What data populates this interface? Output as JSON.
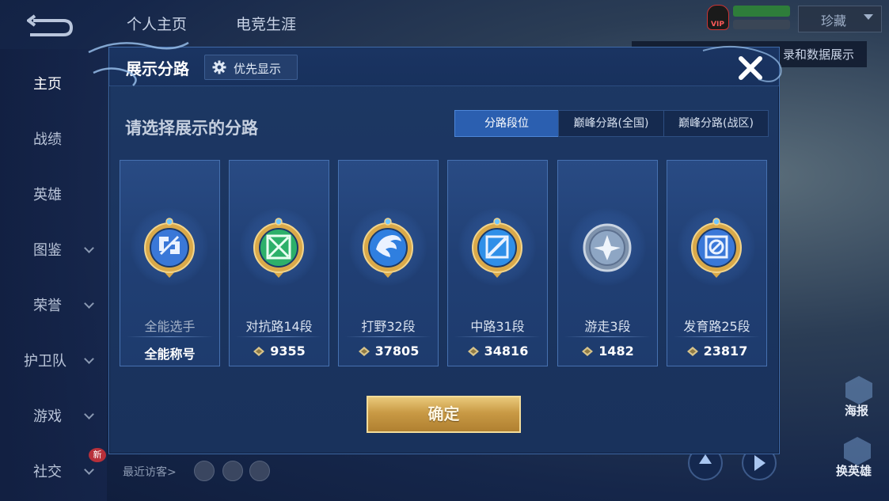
{
  "background": {
    "tabs": [
      "个人主页",
      "电竞生涯"
    ],
    "vip_label": "VIP",
    "dropdown_value": "珍藏",
    "side_strip_text": "录和数据展示",
    "sidebar": [
      {
        "label": "主页",
        "active": true,
        "has_chevron": false
      },
      {
        "label": "战绩",
        "active": false,
        "has_chevron": false
      },
      {
        "label": "英雄",
        "active": false,
        "has_chevron": false
      },
      {
        "label": "图鉴",
        "active": false,
        "has_chevron": true
      },
      {
        "label": "荣誉",
        "active": false,
        "has_chevron": true
      },
      {
        "label": "护卫队",
        "active": false,
        "has_chevron": true
      },
      {
        "label": "游戏",
        "active": false,
        "has_chevron": true
      },
      {
        "label": "社交",
        "active": false,
        "has_chevron": true
      }
    ],
    "new_badge": "新",
    "recent_visitors_label": "最近访客>",
    "right_labels": [
      "海报",
      "换英雄"
    ]
  },
  "modal": {
    "title": "展示分路",
    "priority_button": "优先显示",
    "section_title": "请选择展示的分路",
    "segments": [
      "分路段位",
      "巅峰分路(全国)",
      "巅峰分路(战区)"
    ],
    "active_segment": 0,
    "cards": [
      {
        "name": "全能选手",
        "score": "全能称号",
        "has_diamond": false,
        "emblem": "allround",
        "color": "#3a78d8"
      },
      {
        "name": "对抗路14段",
        "score": "9355",
        "has_diamond": true,
        "emblem": "clash",
        "color": "#2db06a"
      },
      {
        "name": "打野32段",
        "score": "37805",
        "has_diamond": true,
        "emblem": "jungle",
        "color": "#2f7fe0"
      },
      {
        "name": "中路31段",
        "score": "34816",
        "has_diamond": true,
        "emblem": "mid",
        "color": "#2f8fe8"
      },
      {
        "name": "游走3段",
        "score": "1482",
        "has_diamond": true,
        "emblem": "roam",
        "color": "#8ea6c4"
      },
      {
        "name": "发育路25段",
        "score": "23817",
        "has_diamond": true,
        "emblem": "farm",
        "color": "#3a78d8"
      }
    ],
    "confirm_button": "确定",
    "accent_gold": "#d9b062"
  }
}
